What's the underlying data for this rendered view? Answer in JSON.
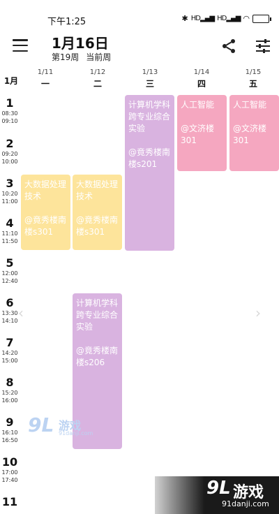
{
  "status": {
    "time": "下午1:25",
    "hd1": "HD",
    "hd2": "HD"
  },
  "header": {
    "date": "1月16日",
    "week": "第19周",
    "current": "当前周"
  },
  "month": "1月",
  "days": [
    {
      "date": "1/11",
      "weekday": "一"
    },
    {
      "date": "1/12",
      "weekday": "二"
    },
    {
      "date": "1/13",
      "weekday": "三"
    },
    {
      "date": "1/14",
      "weekday": "四"
    },
    {
      "date": "1/15",
      "weekday": "五"
    }
  ],
  "slots": [
    {
      "n": "1",
      "start": "08:30",
      "end": "09:10"
    },
    {
      "n": "2",
      "start": "09:20",
      "end": "10:00"
    },
    {
      "n": "3",
      "start": "10:20",
      "end": "11:00"
    },
    {
      "n": "4",
      "start": "11:10",
      "end": "11:50"
    },
    {
      "n": "5",
      "start": "12:00",
      "end": "12:40"
    },
    {
      "n": "6",
      "start": "13:30",
      "end": "14:10"
    },
    {
      "n": "7",
      "start": "14:20",
      "end": "15:00"
    },
    {
      "n": "8",
      "start": "15:20",
      "end": "16:00"
    },
    {
      "n": "9",
      "start": "16:10",
      "end": "16:50"
    },
    {
      "n": "10",
      "start": "17:00",
      "end": "17:40"
    },
    {
      "n": "11",
      "start": "",
      "end": ""
    }
  ],
  "courses": [
    {
      "name": "大数据处理技术",
      "room": "@竟秀楼南楼s301",
      "color": "#fde49b"
    },
    {
      "name": "大数据处理技术",
      "room": "@竟秀楼南楼s301",
      "color": "#fde49b"
    },
    {
      "name": "计算机学科跨专业综合实验",
      "room": "@竟秀楼南楼s201",
      "color": "#d9b3e0"
    },
    {
      "name": "人工智能",
      "room": "@文济楼301",
      "color": "#f5a7c0"
    },
    {
      "name": "人工智能",
      "room": "@文济楼301",
      "color": "#f5a7c0"
    },
    {
      "name": "计算机学科跨专业综合实验",
      "room": "@竟秀楼南楼s206",
      "color": "#d9b3e0"
    }
  ],
  "watermark": {
    "logo": "9L",
    "name": "游戏",
    "url": "91danji.com"
  },
  "icons": [
    "bluetooth-icon",
    "signal-icon",
    "wifi-icon",
    "battery-icon",
    "menu-icon",
    "share-icon",
    "tune-icon",
    "chevron-left-icon",
    "chevron-right-icon"
  ]
}
